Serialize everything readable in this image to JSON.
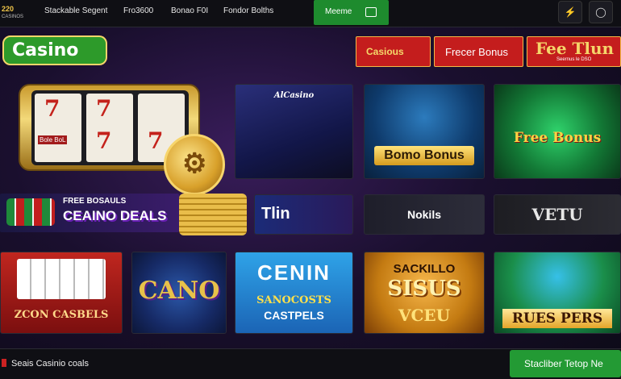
{
  "topnav": {
    "logo_top": "220",
    "logo_bottom": "CASINOS",
    "links": [
      "Stackable Segent",
      "Fro3600",
      "Bonao F0I",
      "Fondor Bolths"
    ],
    "menu_label": "Meeme",
    "icons": [
      "wallet-icon",
      "lightning-icon",
      "user-icon"
    ]
  },
  "logo": {
    "text": "Casino"
  },
  "tabs": [
    "Casious",
    "Frecer Bonus"
  ],
  "feature_tab": {
    "title": "Fee Tlun",
    "subtitle": "Seernus le DSO"
  },
  "hero": {
    "slot_reels": [
      "7",
      "7",
      "7"
    ],
    "slot_label": "Bole BoL",
    "deals_top": "FREE BOSAULS",
    "deals_main": "CEAINO DEALS"
  },
  "games": {
    "g1": "AlCasino",
    "g2": "Bomo Bonus",
    "g3": "Free Bonus",
    "g5": "Tlin",
    "g6": "Nokils",
    "g7": "VETU",
    "g8": "ZCON CASBELS",
    "g9": "CANO",
    "g10_a": "CENIN",
    "g10_b": "SANOCOSTS",
    "g10_c": "CASTPELS",
    "g11_a": "SACKILLO",
    "g11_b": "SISUS",
    "g11_c": "VCEU",
    "g12": "RUES PERS"
  },
  "footer": {
    "label": "Seais Casinio coals",
    "cta": "Stacliber Tetop Ne"
  },
  "colors": {
    "brand_green": "#239a34",
    "accent_red": "#c41d1d",
    "accent_gold": "#f5d56a"
  }
}
